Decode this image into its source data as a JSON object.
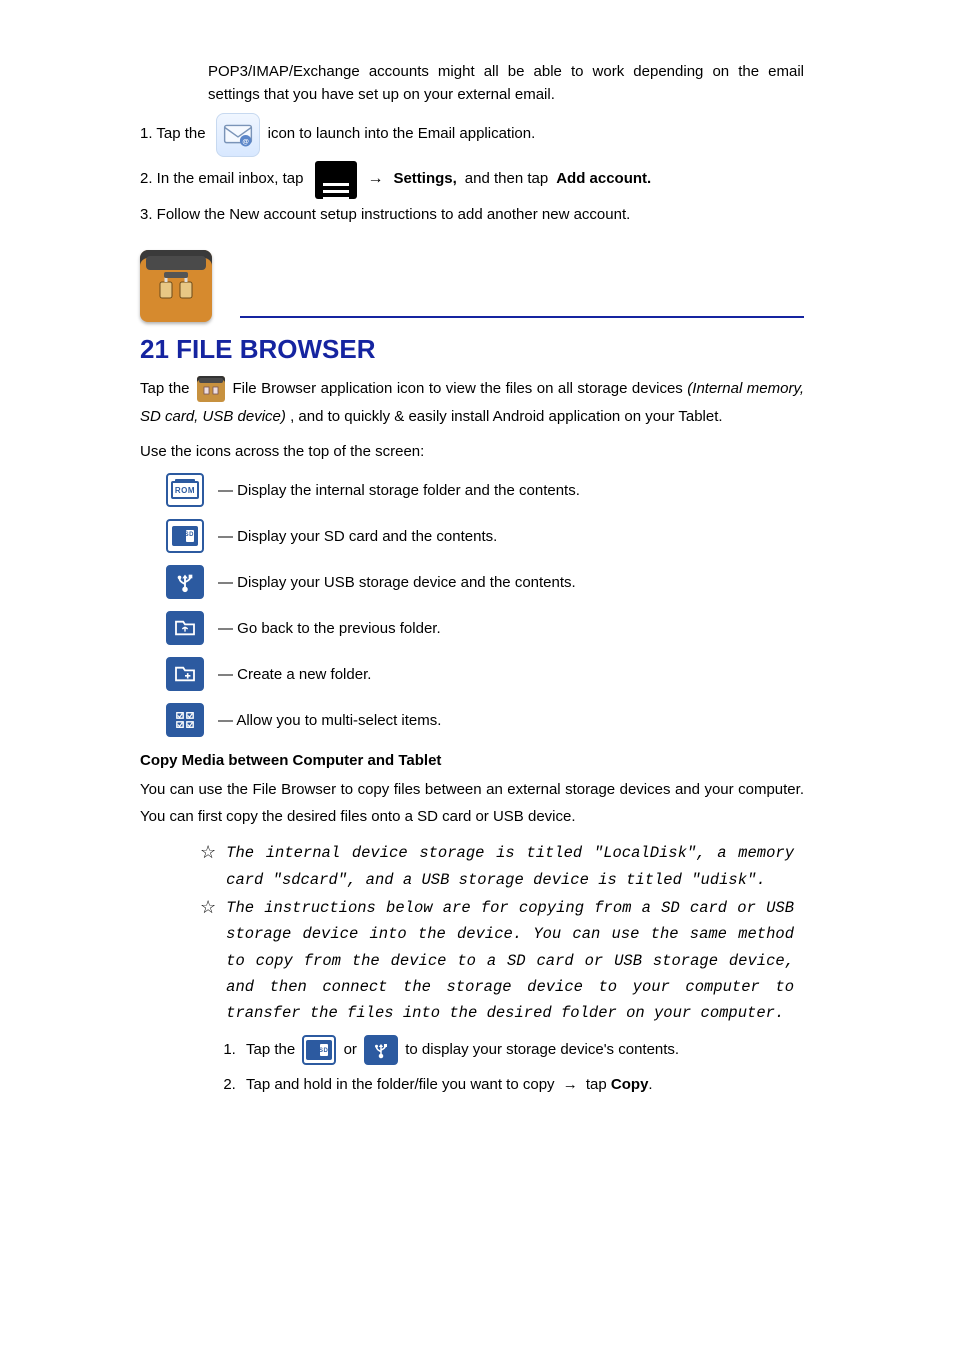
{
  "intro": {
    "line1_a": "POP3/IMAP/Exchange accounts might all be able to work depending on the email",
    "line1_b": "settings that you have set up on your external email.",
    "step1_a": "1. Tap the",
    "step1_b": " icon to launch into the Email application.",
    "step2_a": "2. In the email inbox, tap",
    "step2_arrow": "→",
    "step2_b": "Settings,",
    "step2_c": " and then tap",
    "step2_d": "Add account.",
    "step3": "3. Follow the New account setup instructions to add another new account."
  },
  "heading": "21 FILE BROWSER",
  "open_a": "Tap the ",
  "open_b": " File Browser application icon to view the files on all storage devices",
  "open_c": "(Internal memory, SD card, USB device)",
  "open_d": ", and to quickly & easily install Android",
  "open_e": "application on your Tablet.",
  "toolbar_intro": "Use the icons across the top of the screen:",
  "tools": [
    {
      "label": "— Display the internal storage folder and the contents.",
      "name": "rom"
    },
    {
      "label": "— Display your SD card and the contents.",
      "name": "sd"
    },
    {
      "label": "— Display your USB storage device and the contents.",
      "name": "usb"
    },
    {
      "label": "— Go back to the previous folder.",
      "name": "folder-back"
    },
    {
      "label": "— Create a new folder.",
      "name": "folder-new"
    },
    {
      "label": "— Allow you to multi-select items.",
      "name": "multi-select"
    }
  ],
  "copy_heading": "Copy Media between Computer and Tablet",
  "copy_intro": "You can use the File Browser to copy files between an external storage devices and your computer. You can first copy the desired files onto a SD card or USB device.",
  "notes": [
    "The internal device storage is titled \"LocalDisk\", a memory card \"sdcard\", and a USB storage device is titled \"udisk\".",
    "The instructions below are for copying from a SD card or USB storage device into the device. You can use the same method to copy from the device to a SD card or USB storage device, and then connect the storage device to your computer to transfer the files into the desired folder on your computer."
  ],
  "steps": {
    "s1_a": "Tap the",
    "s1_b": "or",
    "s1_c": "to display your storage device's contents.",
    "s2_a": "Tap and hold in the folder/file you want to copy",
    "s2_arrow": "→",
    "s2_b": " tap ",
    "s2_c": "Copy",
    "s2_d": "."
  }
}
